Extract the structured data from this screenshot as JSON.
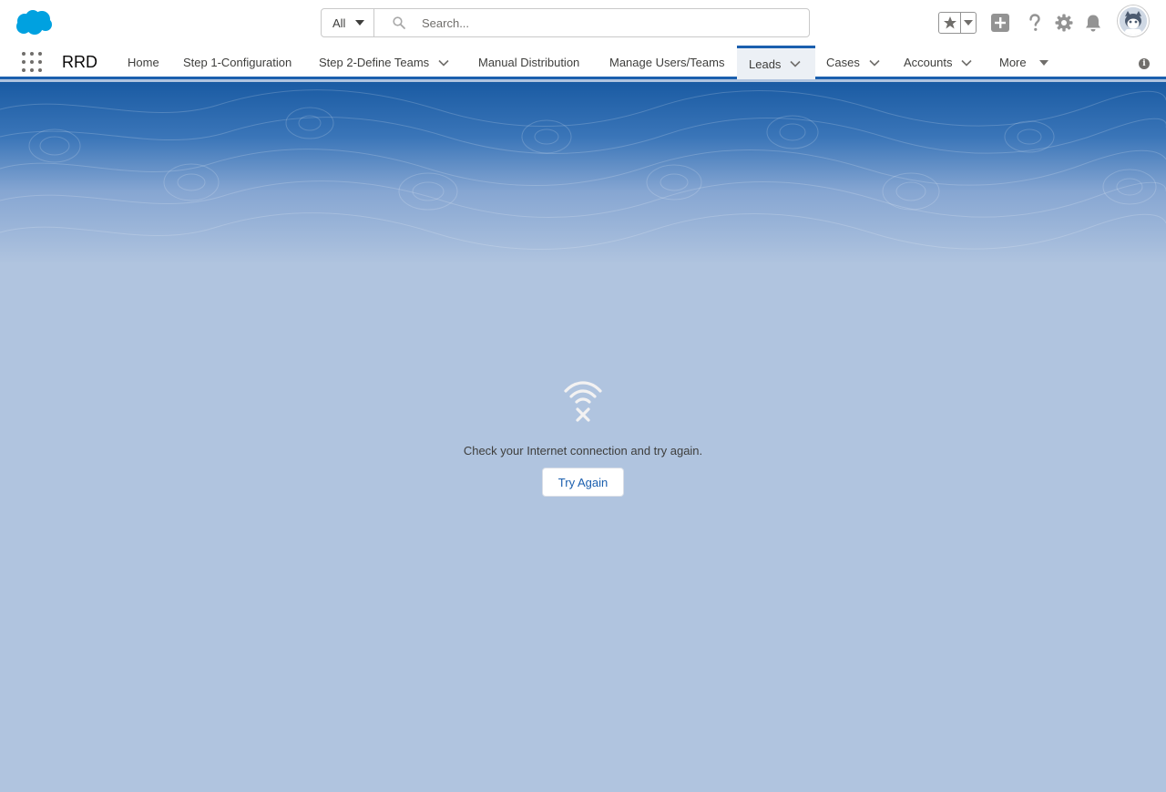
{
  "header": {
    "search_scope": "All",
    "search_placeholder": "Search..."
  },
  "nav": {
    "app_name": "RRD",
    "items": [
      {
        "label": "Home"
      },
      {
        "label": "Step 1-Configuration"
      },
      {
        "label": "Step 2-Define Teams"
      },
      {
        "label": "Manual Distribution"
      },
      {
        "label": "Manage Users/Teams"
      },
      {
        "label": "Leads"
      },
      {
        "label": "Cases"
      },
      {
        "label": "Accounts"
      },
      {
        "label": "More"
      }
    ],
    "active_item": "Leads"
  },
  "offline": {
    "message": "Check your Internet connection and try again.",
    "button_label": "Try Again"
  },
  "colors": {
    "brand": "#1b5fae",
    "background": "#b0c4df",
    "salesforce_cloud": "#00a1e0"
  },
  "icons": [
    "salesforce-logo",
    "search-icon",
    "star-icon",
    "plus-icon",
    "help-icon",
    "gear-icon",
    "bell-icon",
    "avatar",
    "app-launcher-icon",
    "info-icon",
    "wifi-off-icon"
  ]
}
